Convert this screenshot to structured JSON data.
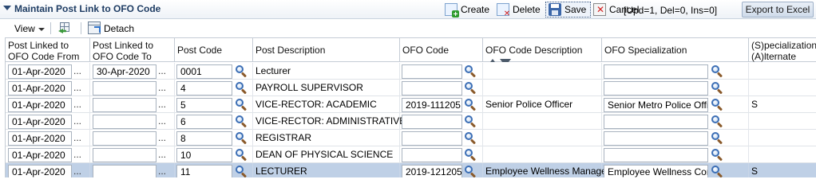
{
  "header": {
    "title": "Maintain Post Link to OFO Code",
    "create_label": "Create",
    "delete_label": "Delete",
    "save_label": "Save",
    "cancel_label": "Cancel",
    "status_text": "[Upd=1, Del=0, Ins=0]",
    "export_label": "Export to Excel"
  },
  "toolbar": {
    "view_label": "View",
    "detach_label": "Detach"
  },
  "columns": {
    "from_date": "Post Linked to OFO Code From Date",
    "to_date": "Post Linked to OFO Code To Date",
    "post_code": "Post Code",
    "post_desc": "Post Description",
    "ofo_code": "OFO Code",
    "ofo_desc": "OFO Code Description",
    "ofo_spec": "OFO Specialization",
    "spec_alt": "(S)pecialization/ (A)lternate"
  },
  "rows": [
    {
      "from": "01-Apr-2020",
      "to": "30-Apr-2020",
      "post_code": "0001",
      "post_desc": "Lecturer",
      "ofo_code": "",
      "ofo_desc": "",
      "ofo_spec": "",
      "spec_alt": "",
      "selected": false
    },
    {
      "from": "01-Apr-2020",
      "to": "",
      "post_code": "4",
      "post_desc": "PAYROLL SUPERVISOR",
      "ofo_code": "",
      "ofo_desc": "",
      "ofo_spec": "",
      "spec_alt": "",
      "selected": false
    },
    {
      "from": "01-Apr-2020",
      "to": "",
      "post_code": "5",
      "post_desc": "VICE-RECTOR: ACADEMIC",
      "ofo_code": "2019-111205",
      "ofo_desc": "Senior Police Officer",
      "ofo_spec": "Senior Metro Police Officer",
      "spec_alt": "S",
      "selected": false
    },
    {
      "from": "01-Apr-2020",
      "to": "",
      "post_code": "6",
      "post_desc": "VICE-RECTOR: ADMINISTRATIVE",
      "ofo_code": "",
      "ofo_desc": "",
      "ofo_spec": "",
      "spec_alt": "",
      "selected": false
    },
    {
      "from": "01-Apr-2020",
      "to": "",
      "post_code": "8",
      "post_desc": "REGISTRAR",
      "ofo_code": "",
      "ofo_desc": "",
      "ofo_spec": "",
      "spec_alt": "",
      "selected": false
    },
    {
      "from": "01-Apr-2020",
      "to": "",
      "post_code": "10",
      "post_desc": "DEAN OF PHYSICAL SCIENCE",
      "ofo_code": "",
      "ofo_desc": "",
      "ofo_spec": "",
      "spec_alt": "",
      "selected": false
    },
    {
      "from": "01-Apr-2020",
      "to": "",
      "post_code": "11",
      "post_desc": "LECTURER",
      "ofo_code": "2019-121205",
      "ofo_desc": "Employee Wellness Manager",
      "ofo_spec": "Employee Wellness Consultant",
      "spec_alt": "S",
      "selected": true
    }
  ],
  "date_picker_glyph": "...",
  "colors": {
    "title": "#1e3c63",
    "selected_row": "#bfd0e6",
    "header_bg": "#eef2f7"
  }
}
